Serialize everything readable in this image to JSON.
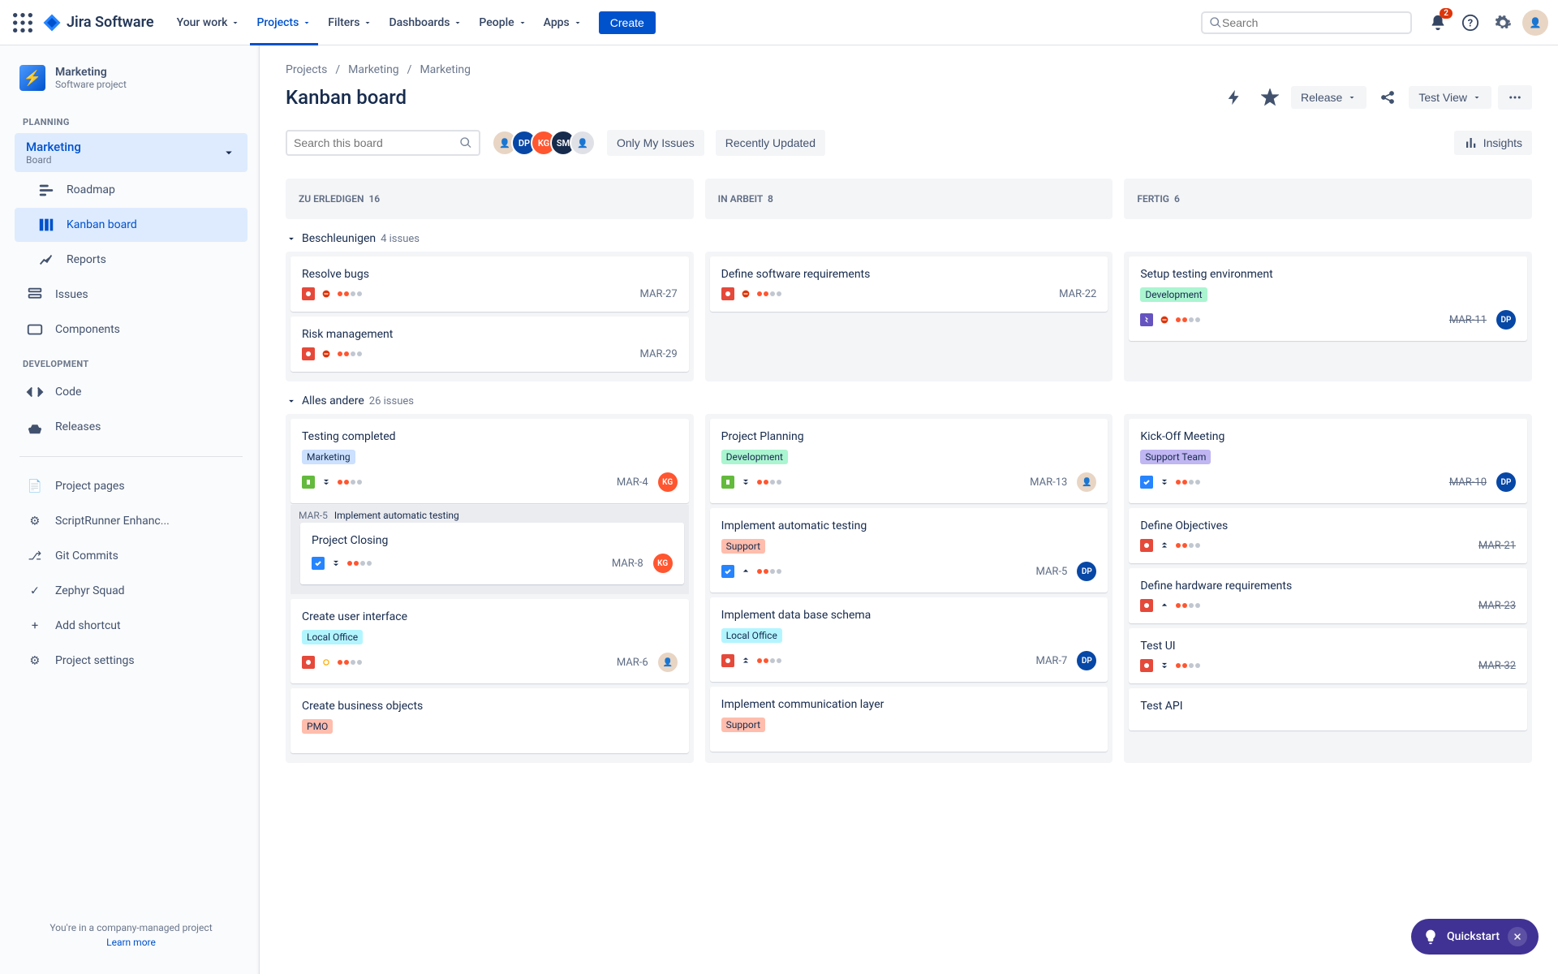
{
  "topnav": {
    "logo": "Jira Software",
    "items": [
      "Your work",
      "Projects",
      "Filters",
      "Dashboards",
      "People",
      "Apps"
    ],
    "active_index": 1,
    "create": "Create",
    "search_placeholder": "Search",
    "notification_count": "2"
  },
  "sidebar": {
    "project_name": "Marketing",
    "project_type": "Software project",
    "planning_label": "PLANNING",
    "board_selector_name": "Marketing",
    "board_selector_sub": "Board",
    "planning_items": [
      "Roadmap",
      "Kanban board",
      "Reports"
    ],
    "planning_selected": 1,
    "issues": "Issues",
    "components": "Components",
    "development_label": "DEVELOPMENT",
    "dev_items": [
      "Code",
      "Releases"
    ],
    "extra_items": [
      "Project pages",
      "ScriptRunner Enhanc...",
      "Git Commits",
      "Zephyr Squad",
      "Add shortcut",
      "Project settings"
    ],
    "footer_line": "You're in a company-managed project",
    "footer_link": "Learn more"
  },
  "breadcrumb": [
    "Projects",
    "Marketing",
    "Marketing"
  ],
  "board_title": "Kanban board",
  "actions": {
    "release": "Release",
    "view": "Test View"
  },
  "filters": {
    "search_placeholder": "Search this board",
    "avatars": [
      "",
      "DP",
      "KG",
      "SM",
      ""
    ],
    "only_my": "Only My Issues",
    "recently_updated": "Recently Updated",
    "insights": "Insights"
  },
  "columns": [
    {
      "name": "ZU ERLEDIGEN",
      "count": "16"
    },
    {
      "name": "IN ARBEIT",
      "count": "8"
    },
    {
      "name": "FERTIG",
      "count": "6"
    }
  ],
  "swimlanes": [
    {
      "name": "Beschleunigen",
      "count": "4 issues",
      "cols": [
        [
          {
            "title": "Resolve bugs",
            "type": "bug",
            "prio": "block",
            "key": "MAR-27"
          },
          {
            "title": "Risk management",
            "type": "bug",
            "prio": "block",
            "key": "MAR-29"
          }
        ],
        [
          {
            "title": "Define software requirements",
            "type": "bug",
            "prio": "block",
            "key": "MAR-22"
          }
        ],
        [
          {
            "title": "Setup testing environment",
            "tag": "Development",
            "tag_color": "#ABF5D1",
            "type": "epic",
            "prio": "block",
            "key": "MAR-11",
            "done": true,
            "assignee": "DP",
            "assignee_color": "#0747A6"
          }
        ]
      ]
    },
    {
      "name": "Alles andere",
      "count": "26 issues",
      "cols": [
        [
          {
            "title": "Testing completed",
            "tag": "Marketing",
            "tag_color": "#CCE0FF",
            "type": "story",
            "prio": "lowest",
            "key": "MAR-4",
            "assignee": "KG",
            "assignee_color": "#FF5630"
          },
          {
            "sub_key": "MAR-5",
            "sub_title": "Implement automatic testing",
            "title": "Project Closing",
            "type": "task",
            "prio": "lowest",
            "key": "MAR-8",
            "assignee": "KG",
            "assignee_color": "#FF5630",
            "nested": true
          },
          {
            "title": "Create user interface",
            "tag": "Local Office",
            "tag_color": "#B3F5FF",
            "type": "bug",
            "prio": "med",
            "key": "MAR-6",
            "assignee": "",
            "assignee_color": "#e8d5c4"
          },
          {
            "title": "Create business objects",
            "tag": "PMO",
            "tag_color": "#FFBDAD",
            "truncated": true
          }
        ],
        [
          {
            "title": "Project Planning",
            "tag": "Development",
            "tag_color": "#ABF5D1",
            "type": "story",
            "prio": "lowest",
            "key": "MAR-13",
            "assignee": "",
            "assignee_color": "#e8d5c4"
          },
          {
            "title": "Implement automatic testing",
            "tag": "Support",
            "tag_color": "#FFBDAD",
            "type": "task",
            "prio": "high",
            "key": "MAR-5",
            "assignee": "DP",
            "assignee_color": "#0747A6"
          },
          {
            "title": "Implement data base schema",
            "tag": "Local Office",
            "tag_color": "#B3F5FF",
            "type": "bug",
            "prio": "highest",
            "key": "MAR-7",
            "assignee": "DP",
            "assignee_color": "#0747A6"
          },
          {
            "title": "Implement communication layer",
            "tag": "Support",
            "tag_color": "#FFBDAD",
            "truncated": true
          }
        ],
        [
          {
            "title": "Kick-Off Meeting",
            "tag": "Support Team",
            "tag_color": "#C0B6F2",
            "type": "task",
            "prio": "lowest",
            "key": "MAR-10",
            "done": true,
            "assignee": "DP",
            "assignee_color": "#0747A6"
          },
          {
            "title": "Define Objectives",
            "type": "bug",
            "prio": "highest",
            "key": "MAR-21",
            "done": true
          },
          {
            "title": "Define hardware requirements",
            "type": "bug",
            "prio": "high",
            "key": "MAR-23",
            "done": true
          },
          {
            "title": "Test UI",
            "type": "bug",
            "prio": "lowest",
            "key": "MAR-32",
            "done": true
          },
          {
            "title": "Test API",
            "truncated": true
          }
        ]
      ]
    }
  ],
  "quickstart": "Quickstart",
  "colors": {
    "accent": "#0052CC"
  }
}
